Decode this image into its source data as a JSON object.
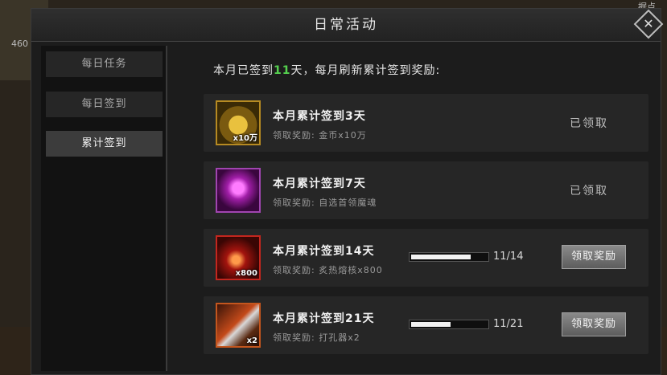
{
  "background": {
    "left_value": "460",
    "top_right_label": "据点"
  },
  "window": {
    "title": "日常活动"
  },
  "sidebar": {
    "tabs": [
      {
        "label": "每日任务"
      },
      {
        "label": "每日签到"
      },
      {
        "label": "累计签到"
      }
    ],
    "active_index": 2
  },
  "header": {
    "prefix": "本月已签到",
    "days": "11",
    "suffix": "天，每月刷新累计签到奖励:"
  },
  "rewards": [
    {
      "icon": "gold-coins-icon",
      "quantity": "x10万",
      "title": "本月累计签到3天",
      "reward": "领取奖励: 金币x10万",
      "status": "已领取"
    },
    {
      "icon": "purple-skull-soul-icon",
      "quantity": "",
      "title": "本月累计签到7天",
      "reward": "领取奖励: 自选首领魔魂",
      "status": "已领取"
    },
    {
      "icon": "fire-core-icon",
      "quantity": "x800",
      "title": "本月累计签到14天",
      "reward": "领取奖励: 炙热熔核x800",
      "progress_text": "11/14",
      "progress": 0.786,
      "button": "领取奖励"
    },
    {
      "icon": "blade-punch-icon",
      "quantity": "x2",
      "title": "本月累计签到21天",
      "reward": "领取奖励: 打孔器x2",
      "progress_text": "11/21",
      "progress": 0.524,
      "button": "领取奖励"
    }
  ]
}
